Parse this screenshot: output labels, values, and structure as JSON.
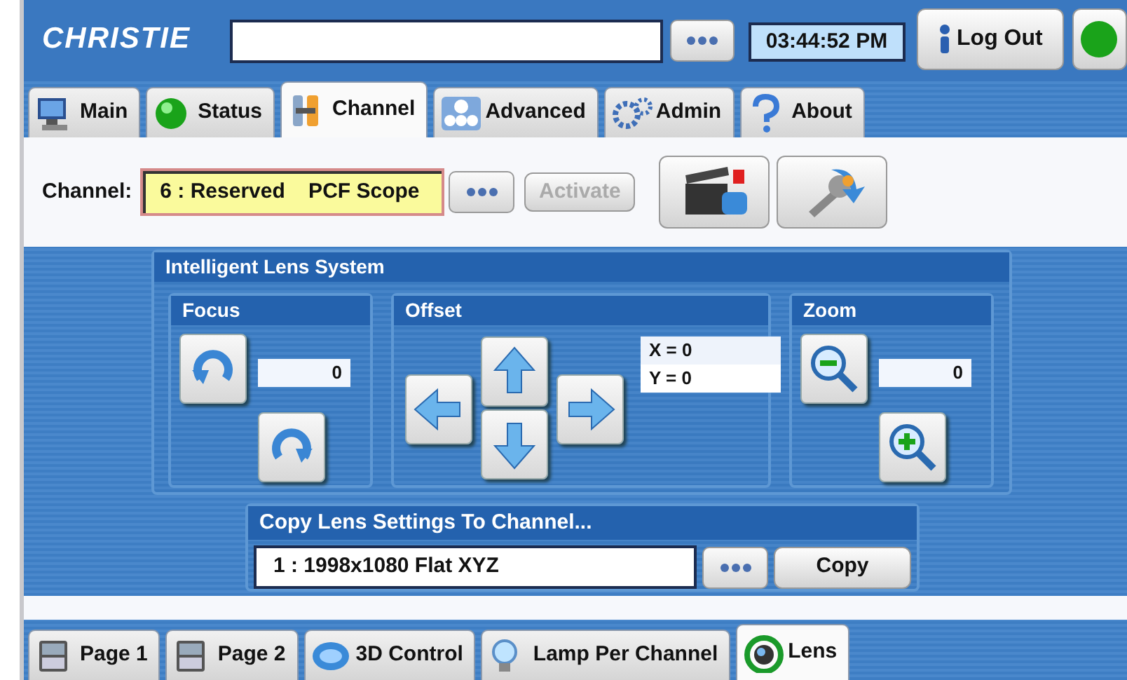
{
  "header": {
    "logo": "CHRISTIE",
    "time": "03:44:52 PM",
    "logout": "Log Out",
    "status_on": true
  },
  "tabs": [
    {
      "label": "Main",
      "kind": "monitor",
      "selected": false
    },
    {
      "label": "Status",
      "kind": "status",
      "selected": false
    },
    {
      "label": "Channel",
      "kind": "tools",
      "selected": true
    },
    {
      "label": "Advanced",
      "kind": "gauges",
      "selected": false
    },
    {
      "label": "Admin",
      "kind": "gears",
      "selected": false
    },
    {
      "label": "About",
      "kind": "help",
      "selected": false
    }
  ],
  "channel": {
    "label": "Channel:",
    "value": "6 : Reserved    PCF Scope",
    "activate": {
      "label": "Activate",
      "disabled": true
    }
  },
  "lens_system": {
    "title": "Intelligent Lens System",
    "focus": {
      "title": "Focus",
      "value": "0"
    },
    "offset": {
      "title": "Offset",
      "x": "X = 0",
      "y": "Y = 0"
    },
    "zoom": {
      "title": "Zoom",
      "value": "0"
    }
  },
  "copy": {
    "title": "Copy Lens Settings To Channel...",
    "value": "1 : 1998x1080 Flat XYZ",
    "button": "Copy"
  },
  "bottom_tabs": [
    {
      "label": "Page 1",
      "kind": "page",
      "selected": false
    },
    {
      "label": "Page 2",
      "kind": "page",
      "selected": false
    },
    {
      "label": "3D Control",
      "kind": "stereo",
      "selected": false
    },
    {
      "label": "Lamp Per Channel",
      "kind": "bulb",
      "selected": false
    },
    {
      "label": "Lens",
      "kind": "lens",
      "selected": true
    }
  ]
}
